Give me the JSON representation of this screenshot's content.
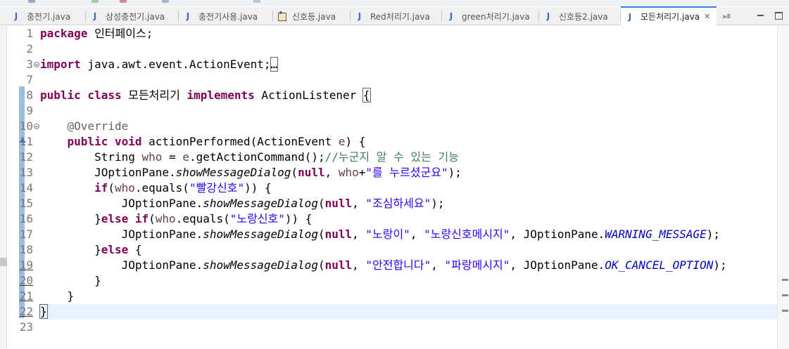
{
  "colors": {
    "keyword": "#7f0055",
    "string": "#2a00ff",
    "comment": "#3f7f5f",
    "constant": "#0000c0",
    "annotation": "#646464",
    "current_line": "#e8f2fe",
    "active_tab_border": "#3c7fd6"
  },
  "tabs": [
    {
      "label": "충전기.java",
      "icon": "java-file-icon"
    },
    {
      "label": "삼성충전기.java",
      "icon": "java-file-icon"
    },
    {
      "label": "충전기사용.java",
      "icon": "java-file-icon"
    },
    {
      "label": "신호등.java",
      "icon": "java-class-main-icon"
    },
    {
      "label": "Red처리기.java",
      "icon": "java-file-icon"
    },
    {
      "label": "green처리기.java",
      "icon": "java-file-icon"
    },
    {
      "label": "신호등2.java",
      "icon": "java-file-icon"
    },
    {
      "label": "모든처리기.java",
      "icon": "java-file-icon",
      "active": true
    }
  ],
  "tab_overflow": {
    "label": "»",
    "count": "8"
  },
  "close_glyph": "✕",
  "editor": {
    "line_numbers": [
      "1",
      "2",
      "3",
      "7",
      "8",
      "9",
      "10",
      "11",
      "12",
      "13",
      "14",
      "15",
      "16",
      "17",
      "18",
      "19",
      "20",
      "21",
      "22",
      "23"
    ],
    "code": {
      "pkg_kw": "package",
      "pkg_name": " 인터페이스;",
      "imp_kw": "import",
      "imp_name": " java.awt.event.ActionEvent;",
      "imp_fold": "…",
      "cls_kw1": "public",
      "cls_kw2": " class",
      "cls_name": " 모든처리기 ",
      "cls_kw3": "implements",
      "cls_iface": " ActionListener ",
      "cls_brace": "{",
      "override": "@Override",
      "m_kw1": "public",
      "m_kw2": " void",
      "m_sig": " actionPerformed(ActionEvent ",
      "m_param": "e",
      "m_end": ") {",
      "l12_a": "String ",
      "l12_var": "who",
      "l12_b": " = ",
      "l12_e": "e",
      "l12_c": ".getActionCommand();",
      "l12_cm": "//누군지 알 수 있는 기능",
      "l13_a": "JOptionPane.",
      "l13_m": "showMessageDialog",
      "l13_b": "(",
      "l13_null": "null",
      "l13_c": ", ",
      "l13_var": "who",
      "l13_d": "+",
      "l13_str": "\"를 누르셨군요\"",
      "l13_e": ");",
      "l14_kw": "if",
      "l14_a": "(",
      "l14_var": "who",
      "l14_b": ".equals(",
      "l14_str": "\"빨강신호\"",
      "l14_c": ")) {",
      "l15_a": "JOptionPane.",
      "l15_m": "showMessageDialog",
      "l15_b": "(",
      "l15_null": "null",
      "l15_c": ", ",
      "l15_str": "\"조심하세요\"",
      "l15_d": ");",
      "l16_a": "}",
      "l16_kw1": "else",
      "l16_kw2": " if",
      "l16_b": "(",
      "l16_var": "who",
      "l16_c": ".equals(",
      "l16_str": "\"노랑신호\"",
      "l16_d": ")) {",
      "l17_a": "JOptionPane.",
      "l17_m": "showMessageDialog",
      "l17_b": "(",
      "l17_null": "null",
      "l17_c": ", ",
      "l17_str1": "\"노랑이\"",
      "l17_d": ", ",
      "l17_str2": "\"노랑신호메시지\"",
      "l17_e": ", JOptionPane.",
      "l17_const": "WARNING_MESSAGE",
      "l17_f": ");",
      "l18_a": "}",
      "l18_kw": "else",
      "l18_b": " {",
      "l19_a": "JOptionPane.",
      "l19_m": "showMessageDialog",
      "l19_b": "(",
      "l19_null": "null",
      "l19_c": ", ",
      "l19_str1": "\"안전합니다\"",
      "l19_d": ", ",
      "l19_str2": "\"파랑메시지\"",
      "l19_e": ", JOptionPane.",
      "l19_const": "OK_CANCEL_OPTION",
      "l19_f": ");",
      "l20": "}",
      "l21": "}",
      "l22": "}"
    }
  }
}
